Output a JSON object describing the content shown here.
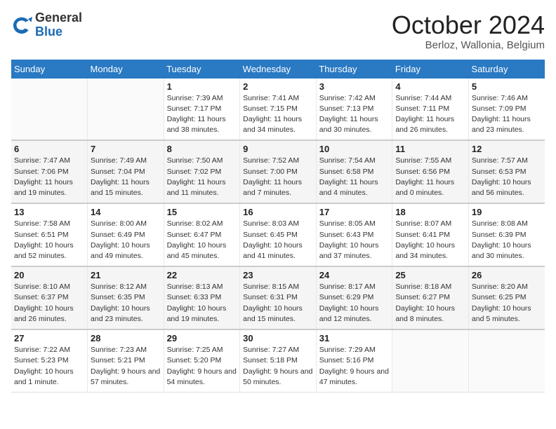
{
  "header": {
    "logo_general": "General",
    "logo_blue": "Blue",
    "month_title": "October 2024",
    "subtitle": "Berloz, Wallonia, Belgium"
  },
  "weekdays": [
    "Sunday",
    "Monday",
    "Tuesday",
    "Wednesday",
    "Thursday",
    "Friday",
    "Saturday"
  ],
  "weeks": [
    [
      null,
      null,
      {
        "day": "1",
        "sunrise": "Sunrise: 7:39 AM",
        "sunset": "Sunset: 7:17 PM",
        "daylight": "Daylight: 11 hours and 38 minutes."
      },
      {
        "day": "2",
        "sunrise": "Sunrise: 7:41 AM",
        "sunset": "Sunset: 7:15 PM",
        "daylight": "Daylight: 11 hours and 34 minutes."
      },
      {
        "day": "3",
        "sunrise": "Sunrise: 7:42 AM",
        "sunset": "Sunset: 7:13 PM",
        "daylight": "Daylight: 11 hours and 30 minutes."
      },
      {
        "day": "4",
        "sunrise": "Sunrise: 7:44 AM",
        "sunset": "Sunset: 7:11 PM",
        "daylight": "Daylight: 11 hours and 26 minutes."
      },
      {
        "day": "5",
        "sunrise": "Sunrise: 7:46 AM",
        "sunset": "Sunset: 7:09 PM",
        "daylight": "Daylight: 11 hours and 23 minutes."
      }
    ],
    [
      {
        "day": "6",
        "sunrise": "Sunrise: 7:47 AM",
        "sunset": "Sunset: 7:06 PM",
        "daylight": "Daylight: 11 hours and 19 minutes."
      },
      {
        "day": "7",
        "sunrise": "Sunrise: 7:49 AM",
        "sunset": "Sunset: 7:04 PM",
        "daylight": "Daylight: 11 hours and 15 minutes."
      },
      {
        "day": "8",
        "sunrise": "Sunrise: 7:50 AM",
        "sunset": "Sunset: 7:02 PM",
        "daylight": "Daylight: 11 hours and 11 minutes."
      },
      {
        "day": "9",
        "sunrise": "Sunrise: 7:52 AM",
        "sunset": "Sunset: 7:00 PM",
        "daylight": "Daylight: 11 hours and 7 minutes."
      },
      {
        "day": "10",
        "sunrise": "Sunrise: 7:54 AM",
        "sunset": "Sunset: 6:58 PM",
        "daylight": "Daylight: 11 hours and 4 minutes."
      },
      {
        "day": "11",
        "sunrise": "Sunrise: 7:55 AM",
        "sunset": "Sunset: 6:56 PM",
        "daylight": "Daylight: 11 hours and 0 minutes."
      },
      {
        "day": "12",
        "sunrise": "Sunrise: 7:57 AM",
        "sunset": "Sunset: 6:53 PM",
        "daylight": "Daylight: 10 hours and 56 minutes."
      }
    ],
    [
      {
        "day": "13",
        "sunrise": "Sunrise: 7:58 AM",
        "sunset": "Sunset: 6:51 PM",
        "daylight": "Daylight: 10 hours and 52 minutes."
      },
      {
        "day": "14",
        "sunrise": "Sunrise: 8:00 AM",
        "sunset": "Sunset: 6:49 PM",
        "daylight": "Daylight: 10 hours and 49 minutes."
      },
      {
        "day": "15",
        "sunrise": "Sunrise: 8:02 AM",
        "sunset": "Sunset: 6:47 PM",
        "daylight": "Daylight: 10 hours and 45 minutes."
      },
      {
        "day": "16",
        "sunrise": "Sunrise: 8:03 AM",
        "sunset": "Sunset: 6:45 PM",
        "daylight": "Daylight: 10 hours and 41 minutes."
      },
      {
        "day": "17",
        "sunrise": "Sunrise: 8:05 AM",
        "sunset": "Sunset: 6:43 PM",
        "daylight": "Daylight: 10 hours and 37 minutes."
      },
      {
        "day": "18",
        "sunrise": "Sunrise: 8:07 AM",
        "sunset": "Sunset: 6:41 PM",
        "daylight": "Daylight: 10 hours and 34 minutes."
      },
      {
        "day": "19",
        "sunrise": "Sunrise: 8:08 AM",
        "sunset": "Sunset: 6:39 PM",
        "daylight": "Daylight: 10 hours and 30 minutes."
      }
    ],
    [
      {
        "day": "20",
        "sunrise": "Sunrise: 8:10 AM",
        "sunset": "Sunset: 6:37 PM",
        "daylight": "Daylight: 10 hours and 26 minutes."
      },
      {
        "day": "21",
        "sunrise": "Sunrise: 8:12 AM",
        "sunset": "Sunset: 6:35 PM",
        "daylight": "Daylight: 10 hours and 23 minutes."
      },
      {
        "day": "22",
        "sunrise": "Sunrise: 8:13 AM",
        "sunset": "Sunset: 6:33 PM",
        "daylight": "Daylight: 10 hours and 19 minutes."
      },
      {
        "day": "23",
        "sunrise": "Sunrise: 8:15 AM",
        "sunset": "Sunset: 6:31 PM",
        "daylight": "Daylight: 10 hours and 15 minutes."
      },
      {
        "day": "24",
        "sunrise": "Sunrise: 8:17 AM",
        "sunset": "Sunset: 6:29 PM",
        "daylight": "Daylight: 10 hours and 12 minutes."
      },
      {
        "day": "25",
        "sunrise": "Sunrise: 8:18 AM",
        "sunset": "Sunset: 6:27 PM",
        "daylight": "Daylight: 10 hours and 8 minutes."
      },
      {
        "day": "26",
        "sunrise": "Sunrise: 8:20 AM",
        "sunset": "Sunset: 6:25 PM",
        "daylight": "Daylight: 10 hours and 5 minutes."
      }
    ],
    [
      {
        "day": "27",
        "sunrise": "Sunrise: 7:22 AM",
        "sunset": "Sunset: 5:23 PM",
        "daylight": "Daylight: 10 hours and 1 minute."
      },
      {
        "day": "28",
        "sunrise": "Sunrise: 7:23 AM",
        "sunset": "Sunset: 5:21 PM",
        "daylight": "Daylight: 9 hours and 57 minutes."
      },
      {
        "day": "29",
        "sunrise": "Sunrise: 7:25 AM",
        "sunset": "Sunset: 5:20 PM",
        "daylight": "Daylight: 9 hours and 54 minutes."
      },
      {
        "day": "30",
        "sunrise": "Sunrise: 7:27 AM",
        "sunset": "Sunset: 5:18 PM",
        "daylight": "Daylight: 9 hours and 50 minutes."
      },
      {
        "day": "31",
        "sunrise": "Sunrise: 7:29 AM",
        "sunset": "Sunset: 5:16 PM",
        "daylight": "Daylight: 9 hours and 47 minutes."
      },
      null,
      null
    ]
  ]
}
